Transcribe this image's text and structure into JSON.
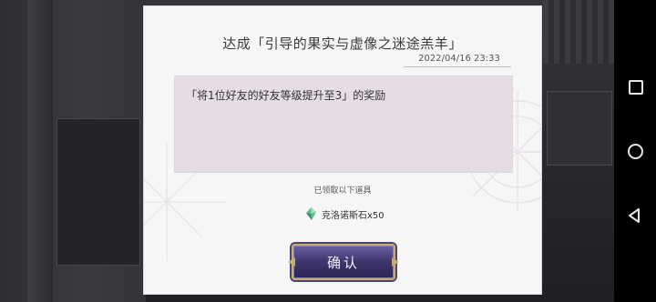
{
  "dialog": {
    "title": "达成「引导的果实与虚像之迷途羔羊」",
    "date": "2022/04/16 23:33",
    "message": "「将1位好友的好友等级提升至3」的奖励",
    "received_label": "已领取以下道具",
    "reward_item": {
      "icon": "crystal-stone-icon",
      "text": "克洛诺斯石x50"
    },
    "confirm_label": "确认"
  },
  "nav_bar": {
    "buttons": [
      "recent-apps",
      "home",
      "back"
    ]
  },
  "colors": {
    "dialog_bg": "#f7f6f7",
    "message_bg": "#e5dde3",
    "button_purple": "#3e356c",
    "button_gold": "#c7ad6d"
  }
}
